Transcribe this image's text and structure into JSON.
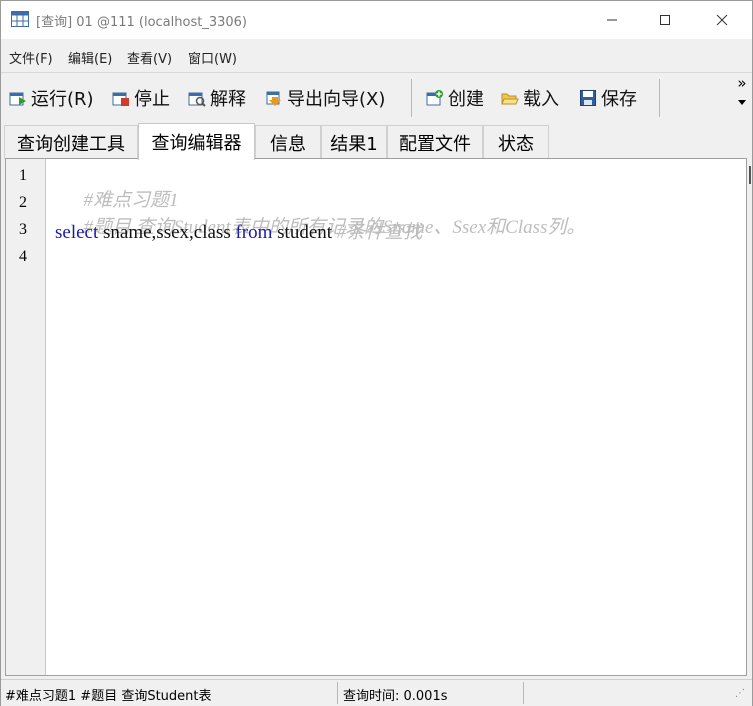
{
  "window": {
    "title": "[查询] 01 @111 (localhost_3306)"
  },
  "menu": [
    "文件(F)",
    "编辑(E)",
    "查看(V)",
    "窗口(W)"
  ],
  "toolbar": {
    "run": "运行(R)",
    "stop": "停止",
    "explain": "解释",
    "export_wizard": "导出向导(X)",
    "create": "创建",
    "load": "载入",
    "save": "保存",
    "overflow": "»"
  },
  "tabs": [
    "查询创建工具",
    "查询编辑器",
    "信息",
    "结果1",
    "配置文件",
    "状态"
  ],
  "active_tab": "查询编辑器",
  "editor": {
    "line_numbers": [
      "1",
      "2",
      "3",
      "4"
    ],
    "lines": {
      "l1_comment": "#难点习题1",
      "l2_comment": "#题目 查询Student表中的所有记录的Sname、Ssex和Class列。",
      "l3_kw1": "select",
      "l3_t1": " sname,ssex,class ",
      "l3_kw2": "from",
      "l3_t2": " student ",
      "l3_comment": "#条件查找"
    }
  },
  "status": {
    "left": "#难点习题1 #题目 查询Student表",
    "query_time": "查询时间: 0.001s"
  },
  "colors": {
    "keyword": "#1a1aa6",
    "comment": "#bdbdbd"
  }
}
